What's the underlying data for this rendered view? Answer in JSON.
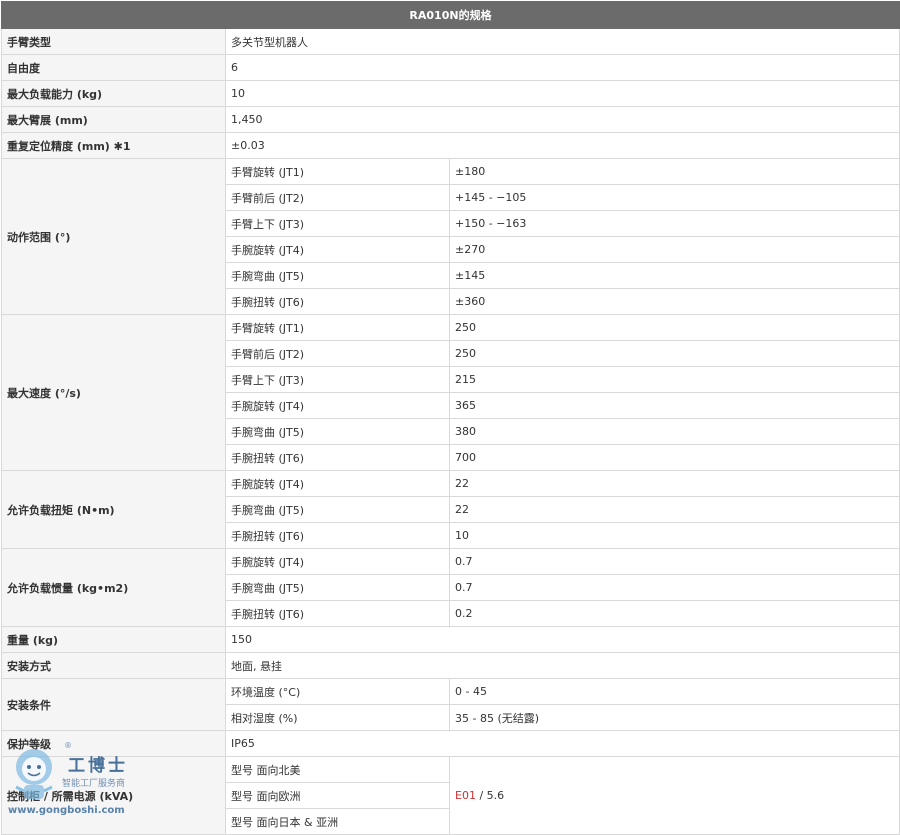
{
  "title": "RA010N的规格",
  "rows": {
    "arm_type": {
      "label": "手臂类型",
      "value": "多关节型机器人"
    },
    "dof": {
      "label": "自由度",
      "value": "6"
    },
    "payload": {
      "label": "最大负载能力 (kg)",
      "value": "10"
    },
    "reach": {
      "label": "最大臂展 (mm)",
      "value": "1,450"
    },
    "repeatability": {
      "label": "重复定位精度 (mm) ✱1",
      "value": "±0.03"
    },
    "motion_range": {
      "label": "动作范围 (°)",
      "items": [
        {
          "axis": "手臂旋转 (JT1)",
          "value": "±180"
        },
        {
          "axis": "手臂前后 (JT2)",
          "value": "+145 - −105"
        },
        {
          "axis": "手臂上下 (JT3)",
          "value": "+150 - −163"
        },
        {
          "axis": "手腕旋转 (JT4)",
          "value": "±270"
        },
        {
          "axis": "手腕弯曲 (JT5)",
          "value": "±145"
        },
        {
          "axis": "手腕扭转 (JT6)",
          "value": "±360"
        }
      ]
    },
    "max_speed": {
      "label": "最大速度 (°/s)",
      "items": [
        {
          "axis": "手臂旋转 (JT1)",
          "value": "250"
        },
        {
          "axis": "手臂前后 (JT2)",
          "value": "250"
        },
        {
          "axis": "手臂上下 (JT3)",
          "value": "215"
        },
        {
          "axis": "手腕旋转 (JT4)",
          "value": "365"
        },
        {
          "axis": "手腕弯曲 (JT5)",
          "value": "380"
        },
        {
          "axis": "手腕扭转 (JT6)",
          "value": "700"
        }
      ]
    },
    "torque": {
      "label": "允许负载扭矩 (N•m)",
      "items": [
        {
          "axis": "手腕旋转 (JT4)",
          "value": "22"
        },
        {
          "axis": "手腕弯曲 (JT5)",
          "value": "22"
        },
        {
          "axis": "手腕扭转 (JT6)",
          "value": "10"
        }
      ]
    },
    "inertia": {
      "label": "允许负载惯量 (kg•m2)",
      "items": [
        {
          "axis": "手腕旋转 (JT4)",
          "value": "0.7"
        },
        {
          "axis": "手腕弯曲 (JT5)",
          "value": "0.7"
        },
        {
          "axis": "手腕扭转 (JT6)",
          "value": "0.2"
        }
      ]
    },
    "weight": {
      "label": "重量 (kg)",
      "value": "150"
    },
    "mounting": {
      "label": "安装方式",
      "value": "地面, 悬挂"
    },
    "conditions": {
      "label": "安装条件",
      "items": [
        {
          "axis": "环境温度 (°C)",
          "value": "0 - 45"
        },
        {
          "axis": "相对湿度 (%)",
          "value": "35 - 85 (无结露)"
        }
      ]
    },
    "protection": {
      "label": "保护等级",
      "value": "IP65"
    },
    "controller": {
      "label": "控制柜 / 所需电源 (kVA)",
      "items": [
        {
          "axis": "型号 面向北美"
        },
        {
          "axis": "型号 面向欧洲"
        },
        {
          "axis": "型号 面向日本 & 亚洲"
        }
      ],
      "value_code": "E01",
      "value_rest": " / 5.6"
    }
  },
  "watermark": {
    "brand": "工博士",
    "subtitle": "智能工厂服务商",
    "url": "www.gongboshi.com",
    "reg": "®"
  },
  "colors": {
    "header_bg": "#6b6b6b",
    "label_bg": "#f5f5f5",
    "border": "#d9d9d9",
    "error_code": "#cc3333"
  }
}
